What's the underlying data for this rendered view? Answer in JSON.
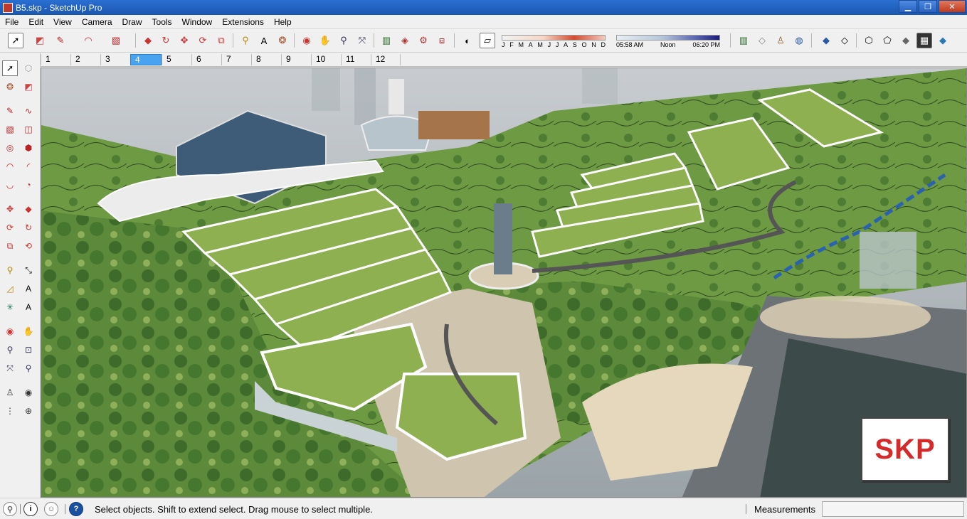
{
  "window": {
    "title": "B5.skp - SketchUp Pro",
    "controls": {
      "minimize": "▁",
      "restore": "❐",
      "close": "✕"
    }
  },
  "menu": [
    "File",
    "Edit",
    "View",
    "Camera",
    "Draw",
    "Tools",
    "Window",
    "Extensions",
    "Help"
  ],
  "shadow_settings": {
    "months": [
      "J",
      "F",
      "M",
      "A",
      "M",
      "J",
      "J",
      "A",
      "S",
      "O",
      "N",
      "D"
    ],
    "time_start": "05:58 AM",
    "time_mid": "Noon",
    "time_end": "06:20 PM"
  },
  "scenes": {
    "tabs": [
      "1",
      "2",
      "3",
      "4",
      "5",
      "6",
      "7",
      "8",
      "9",
      "10",
      "11",
      "12"
    ],
    "active_index": 3
  },
  "viewport": {
    "badge_text": "SKP"
  },
  "status": {
    "message": "Select objects. Shift to extend select. Drag mouse to select multiple.",
    "measurements_label": "Measurements",
    "measurements_value": ""
  },
  "colors": {
    "title_bar": "#1a56b0",
    "scene_active": "#4aa3f0",
    "badge_text": "#d42a2a",
    "help_icon": "#1a4ea0"
  }
}
